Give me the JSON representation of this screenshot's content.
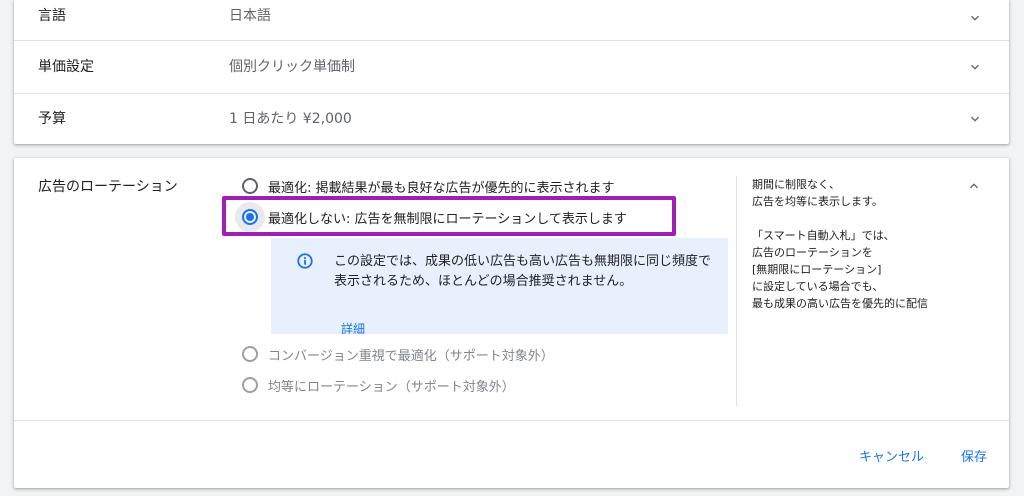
{
  "settings_rows": [
    {
      "label": "言語",
      "value": "日本語"
    },
    {
      "label": "単価設定",
      "value": "個別クリック単価制"
    },
    {
      "label": "予算",
      "value": "1 日あたり ¥2,000"
    }
  ],
  "rotation": {
    "label": "広告のローテーション",
    "options": [
      {
        "label": "最適化: 掲載結果が最も良好な広告が優先的に表示されます",
        "selected": false,
        "disabled": false
      },
      {
        "label": "最適化しない: 広告を無制限にローテーションして表示します",
        "selected": true,
        "disabled": false
      },
      {
        "label": "コンバージョン重視で最適化（サポート対象外）",
        "selected": false,
        "disabled": true
      },
      {
        "label": "均等にローテーション（サポート対象外）",
        "selected": false,
        "disabled": true
      }
    ],
    "info_text": "この設定では、成果の低い広告も高い広告も無期限に同じ頻度で表示されるため、ほとんどの場合推奨されません。",
    "info_link": "詳細",
    "help_lines": [
      "期間に制限なく、",
      "広告を均等に表示します。",
      "",
      "「スマート自動入札」では、",
      "広告のローテーションを",
      "[無期限にローテーション]",
      "に設定している場合でも、",
      "最も成果の高い広告を優先的に配信"
    ],
    "highlight_color": "#a11eb5"
  },
  "actions": {
    "cancel_label": "キャンセル",
    "save_label": "保存"
  },
  "colors": {
    "accent": "#1a73e8",
    "info_bg": "#e8f0fe"
  }
}
